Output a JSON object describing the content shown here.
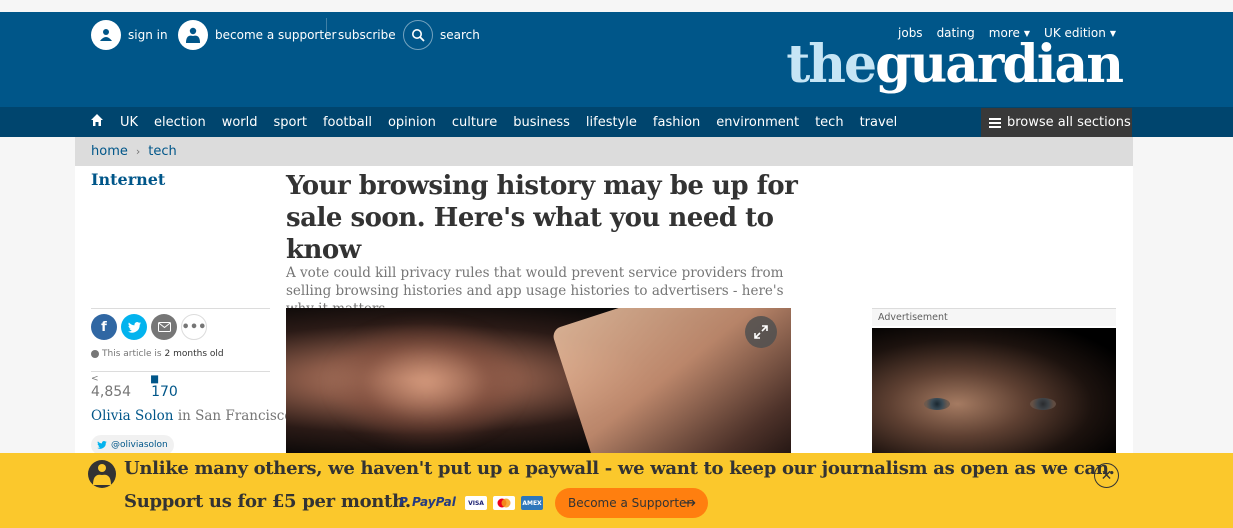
{
  "header": {
    "sign_in": "sign in",
    "become_supporter": "become a supporter",
    "subscribe": "subscribe",
    "search": "search",
    "jobs": "jobs",
    "dating": "dating",
    "more": "more",
    "edition": "UK edition",
    "logo_the": "the",
    "logo_guardian": "guardian"
  },
  "nav": {
    "items": [
      "UK",
      "election",
      "world",
      "sport",
      "football",
      "opinion",
      "culture",
      "business",
      "lifestyle",
      "fashion",
      "environment",
      "tech",
      "travel"
    ],
    "browse_all": "browse all sections"
  },
  "breadcrumb": {
    "home": "home",
    "section": "tech"
  },
  "article": {
    "section_label": "Internet",
    "headline": "Your browsing history may be up for sale soon. Here's what you need to know",
    "standfirst": "A vote could kill privacy rules that would prevent service providers from selling browsing histories and app usage histories to advertisers - here's why it matters",
    "age_prefix": "This article is",
    "age_value": "2 months old",
    "shares": "4,854",
    "comments": "170",
    "author": "Olivia Solon",
    "location": "in San Francisco",
    "twitter": "@oliviasolon"
  },
  "ad": {
    "label": "Advertisement"
  },
  "banner": {
    "line1": "Unlike many others, we haven't put up a paywall - we want to keep our journalism as open as we can.",
    "line2": "Support us for £5 per month.",
    "paypal_pay": "PayPal",
    "cta": "Become a Supporter"
  },
  "colors": {
    "brand_blue": "#005689",
    "nav_blue": "#00456e",
    "banner_yellow": "#fbc82c",
    "cta_orange": "#ff7f0f"
  }
}
